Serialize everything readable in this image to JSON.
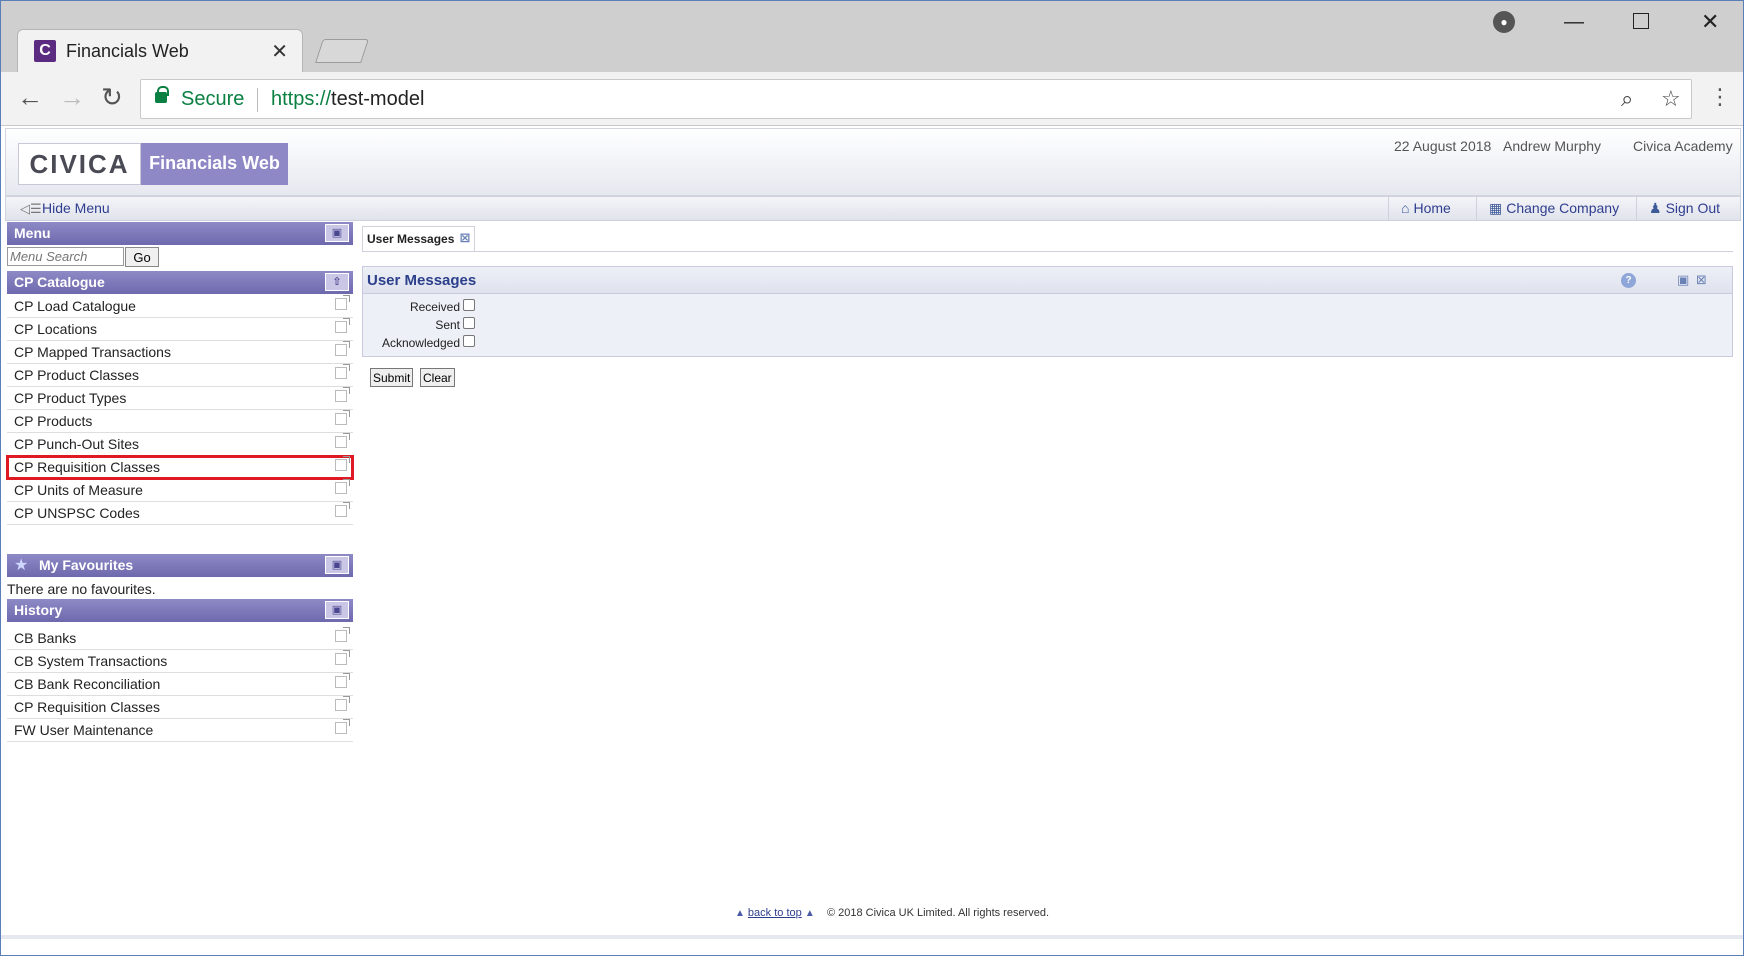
{
  "browser": {
    "tab_title": "Financials Web",
    "tab_favicon": "C",
    "secure_label": "Secure",
    "url_scheme": "https://",
    "url_host": "test-model",
    "icons": [
      "back-icon",
      "forward-icon",
      "reload-icon",
      "zoom-icon",
      "star-icon",
      "kebab-menu-icon",
      "profile-icon",
      "minimize-icon",
      "maximize-icon",
      "close-icon"
    ]
  },
  "header": {
    "logo_text": "CIVICA",
    "product_name": "Financials Web",
    "date": "22 August 2018",
    "user": "Andrew Murphy",
    "company": "Civica Academy"
  },
  "menubar": {
    "hide_menu": "Hide Menu",
    "home": "Home",
    "change_company": "Change Company",
    "sign_out": "Sign Out"
  },
  "menu": {
    "title": "Menu",
    "search_placeholder": "Menu Search",
    "go_label": "Go"
  },
  "catalogue": {
    "title": "CP Catalogue",
    "items": [
      {
        "label": "CP Load Catalogue"
      },
      {
        "label": "CP Locations"
      },
      {
        "label": "CP Mapped Transactions"
      },
      {
        "label": "CP Product Classes"
      },
      {
        "label": "CP Product Types"
      },
      {
        "label": "CP Products"
      },
      {
        "label": "CP Punch-Out Sites"
      },
      {
        "label": "CP Requisition Classes",
        "highlighted": true
      },
      {
        "label": "CP Units of Measure"
      },
      {
        "label": "CP UNSPSC Codes"
      }
    ]
  },
  "favourites": {
    "title": "My Favourites",
    "empty_text": "There are no favourites."
  },
  "history": {
    "title": "History",
    "items": [
      {
        "label": "CB Banks"
      },
      {
        "label": "CB System Transactions"
      },
      {
        "label": "CB Bank Reconciliation"
      },
      {
        "label": "CP Requisition Classes"
      },
      {
        "label": "FW User Maintenance"
      }
    ]
  },
  "content": {
    "tab_label": "User Messages",
    "form_title": "User Messages",
    "fields": [
      {
        "label": "Received",
        "checked": false
      },
      {
        "label": "Sent",
        "checked": false
      },
      {
        "label": "Acknowledged",
        "checked": false
      }
    ],
    "submit_label": "Submit",
    "clear_label": "Clear"
  },
  "footer": {
    "back_to_top": "back to top",
    "copyright": "© 2018 Civica UK Limited. All rights reserved."
  },
  "colors": {
    "panel_header": "#7a76b8",
    "accent_link": "#2f3d8f",
    "highlight_outline": "#e01a22",
    "secure_green": "#0b8043"
  }
}
